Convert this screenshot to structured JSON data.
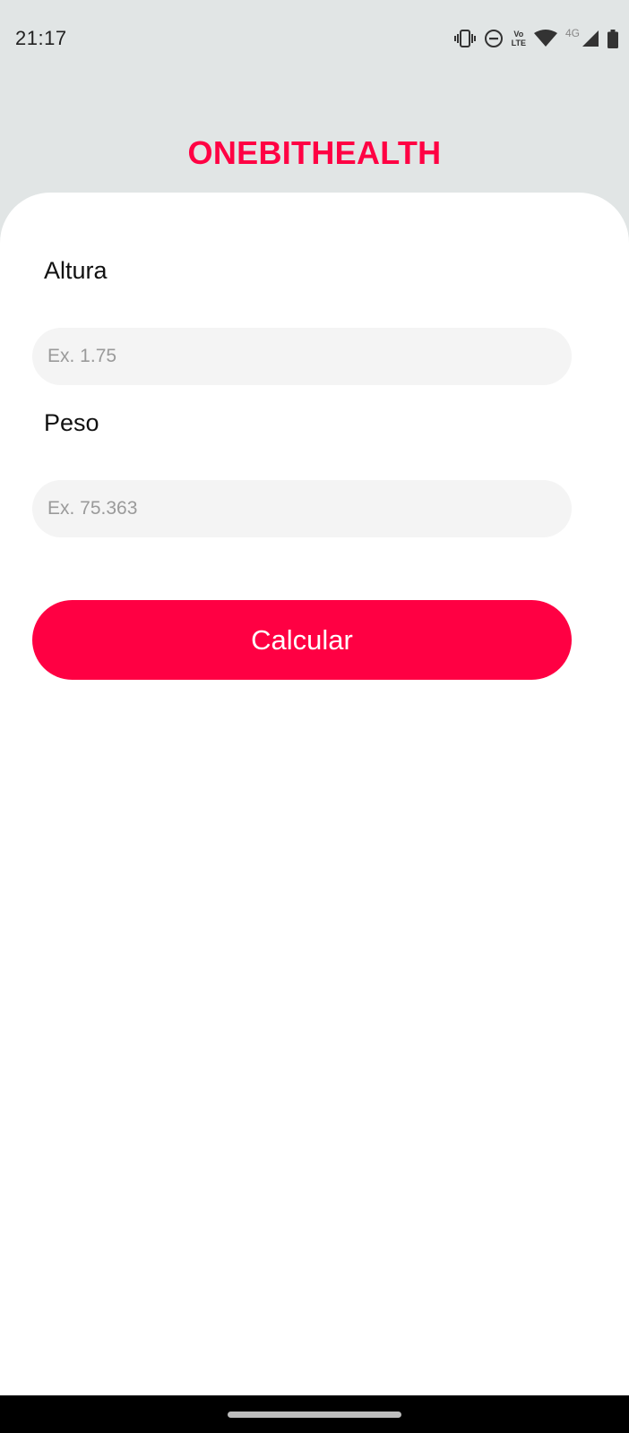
{
  "status_bar": {
    "time": "21:17",
    "icons": [
      "vibrate-icon",
      "do-not-disturb-icon",
      "volte-icon",
      "wifi-icon",
      "network-4g-icon",
      "cell-signal-icon",
      "battery-icon"
    ],
    "volte_top": "Vo",
    "volte_bottom": "LTE",
    "network_type": "4G"
  },
  "app": {
    "title": "ONEBITHEALTH",
    "accent_color": "#ff0043"
  },
  "form": {
    "height_label": "Altura",
    "height_placeholder": "Ex. 1.75",
    "height_value": "",
    "weight_label": "Peso",
    "weight_placeholder": "Ex. 75.363",
    "weight_value": "",
    "calculate_label": "Calcular"
  }
}
